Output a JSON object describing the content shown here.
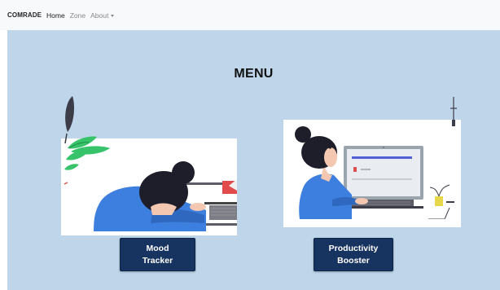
{
  "navbar": {
    "brand": "COMRADE",
    "links": [
      "Home",
      "Zone",
      "About"
    ]
  },
  "main": {
    "title": "MENU",
    "cards": [
      {
        "line1": "Mood",
        "line2": "Tracker",
        "illustration": "woman-head-down-on-laptop"
      },
      {
        "line1": "Productivity",
        "line2": "Booster",
        "illustration": "woman-working-at-laptop"
      }
    ]
  },
  "colors": {
    "navbar_bg": "#f8f9fa",
    "main_bg": "#bed5ea",
    "button_bg": "#17335f",
    "button_text": "#ffffff"
  },
  "icons": [
    "caret-down-icon"
  ]
}
